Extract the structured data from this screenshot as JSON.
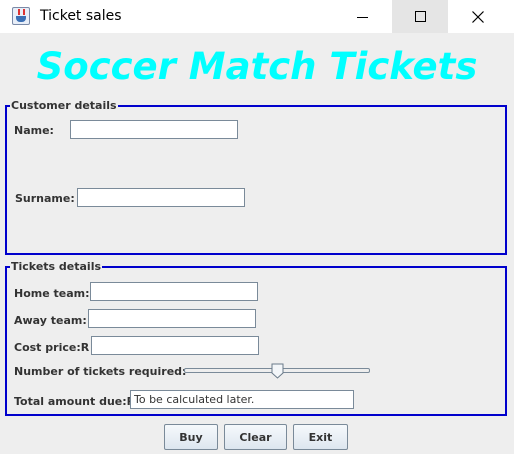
{
  "window": {
    "title": "Ticket sales",
    "icon": "java-cup-icon"
  },
  "heading": {
    "text": "Soccer Match Tickets",
    "color": "#00ffff"
  },
  "customer_details": {
    "legend": "Customer details",
    "name_label": "Name:",
    "name_value": "",
    "surname_label": "Surname:",
    "surname_value": ""
  },
  "tickets_details": {
    "legend": "Tickets details",
    "home_team_label": "Home team:",
    "home_team_value": "",
    "away_team_label": "Away team:",
    "away_team_value": "",
    "cost_price_label": "Cost price:R",
    "cost_price_value": "",
    "num_tickets_label": "Number of tickets required:",
    "num_tickets_slider_level": 0.5,
    "total_label": "Total amount due:R",
    "total_value": "To be calculated later."
  },
  "buttons": {
    "buy": "Buy",
    "clear": "Clear",
    "exit": "Exit"
  },
  "colors": {
    "group_border": "#0000cc",
    "heading": "#00ffff"
  }
}
